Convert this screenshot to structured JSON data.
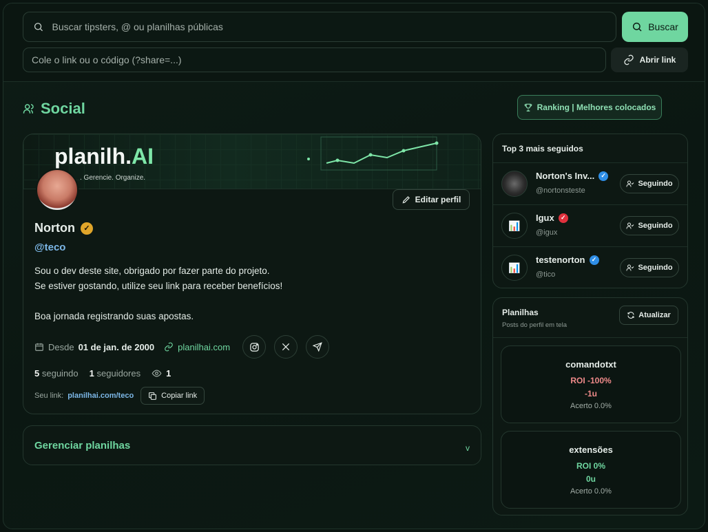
{
  "search": {
    "placeholder": "Buscar tipsters, @ ou planilhas públicas",
    "button_label": "Buscar"
  },
  "link": {
    "placeholder": "Cole o link ou o código (?share=...)",
    "button_label": "Abrir link"
  },
  "section": {
    "title": "Social",
    "ranking_label": "Ranking | Melhores colocados"
  },
  "profile": {
    "banner_brand": "planilh.",
    "banner_brand_ai": "AI",
    "banner_tagline": ". Gerencie. Organize.",
    "edit_label": "Editar perfil",
    "name": "Norton",
    "handle": "@teco",
    "bio_line1": "Sou o dev deste site, obrigado por fazer parte do projeto.",
    "bio_line2": "Se estiver gostando, utilize seu link para receber benefícios!",
    "bio_line3": "Boa jornada registrando suas apostas.",
    "since_prefix": "Desde",
    "since_date": "01 de jan. de 2000",
    "site": "planilhai.com",
    "following_count": "5",
    "following_label": "seguindo",
    "followers_count": "1",
    "followers_label": "seguidores",
    "views_count": "1",
    "your_link_label": "Seu link:",
    "your_link_url": "planilhai.com/teco",
    "copy_label": "Copiar link"
  },
  "manage": {
    "title": "Gerenciar planilhas",
    "chevron": "v"
  },
  "top3": {
    "title": "Top 3 mais seguidos",
    "items": [
      {
        "name": "Norton's Inv...",
        "handle": "@nortonsteste",
        "badge": "blue",
        "button": "Seguindo"
      },
      {
        "name": "Igux",
        "handle": "@igux",
        "badge": "red",
        "button": "Seguindo"
      },
      {
        "name": "testenorton",
        "handle": "@tico",
        "badge": "blue",
        "button": "Seguindo"
      }
    ]
  },
  "planilhas": {
    "title": "Planilhas",
    "subtitle": "Posts do perfil em tela",
    "refresh_label": "Atualizar",
    "items": [
      {
        "name": "comandotxt",
        "roi": "ROI -100%",
        "units": "-1u",
        "acerto": "Acerto 0.0%"
      },
      {
        "name": "extensões",
        "roi": "ROI 0%",
        "units": "0u",
        "acerto": "Acerto 0.0%"
      }
    ]
  },
  "colors": {
    "accent": "#6fd6a0",
    "link": "#7db8e8",
    "negative": "#ef8a8a"
  }
}
